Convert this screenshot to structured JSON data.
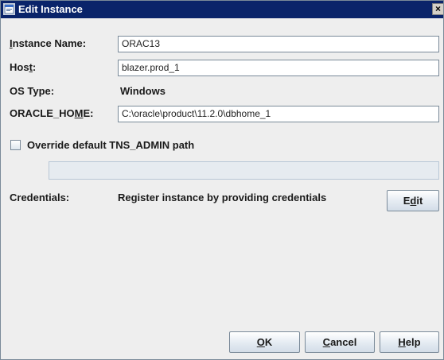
{
  "window": {
    "title": "Edit Instance",
    "close_glyph": "×"
  },
  "form": {
    "instance_name": {
      "label_pre": "",
      "label_key": "I",
      "label_post": "nstance Name:",
      "value": "ORAC13"
    },
    "host": {
      "label_pre": "Hos",
      "label_key": "t",
      "label_post": ":",
      "value": "blazer.prod_1"
    },
    "os_type": {
      "label": "OS Type:",
      "value": "Windows"
    },
    "oracle_home": {
      "label_pre": "ORACLE_HO",
      "label_key": "M",
      "label_post": "E:",
      "value": "C:\\oracle\\product\\11.2.0\\dbhome_1"
    },
    "override_tns": {
      "label": "Override default TNS_ADMIN path",
      "checked": false,
      "path_value": ""
    },
    "credentials": {
      "label": "Credentials:",
      "text": "Register instance by providing credentials",
      "edit_pre": "E",
      "edit_key": "d",
      "edit_post": "it"
    }
  },
  "buttons": {
    "ok_key": "O",
    "ok_post": "K",
    "cancel_key": "C",
    "cancel_post": "ancel",
    "help_key": "H",
    "help_post": "elp"
  },
  "colors": {
    "titlebar": "#0a246a",
    "dialog_bg": "#eeeeee",
    "field_border": "#7a8a99"
  },
  "icons": {
    "app": "window-app-icon",
    "close": "close-icon"
  }
}
